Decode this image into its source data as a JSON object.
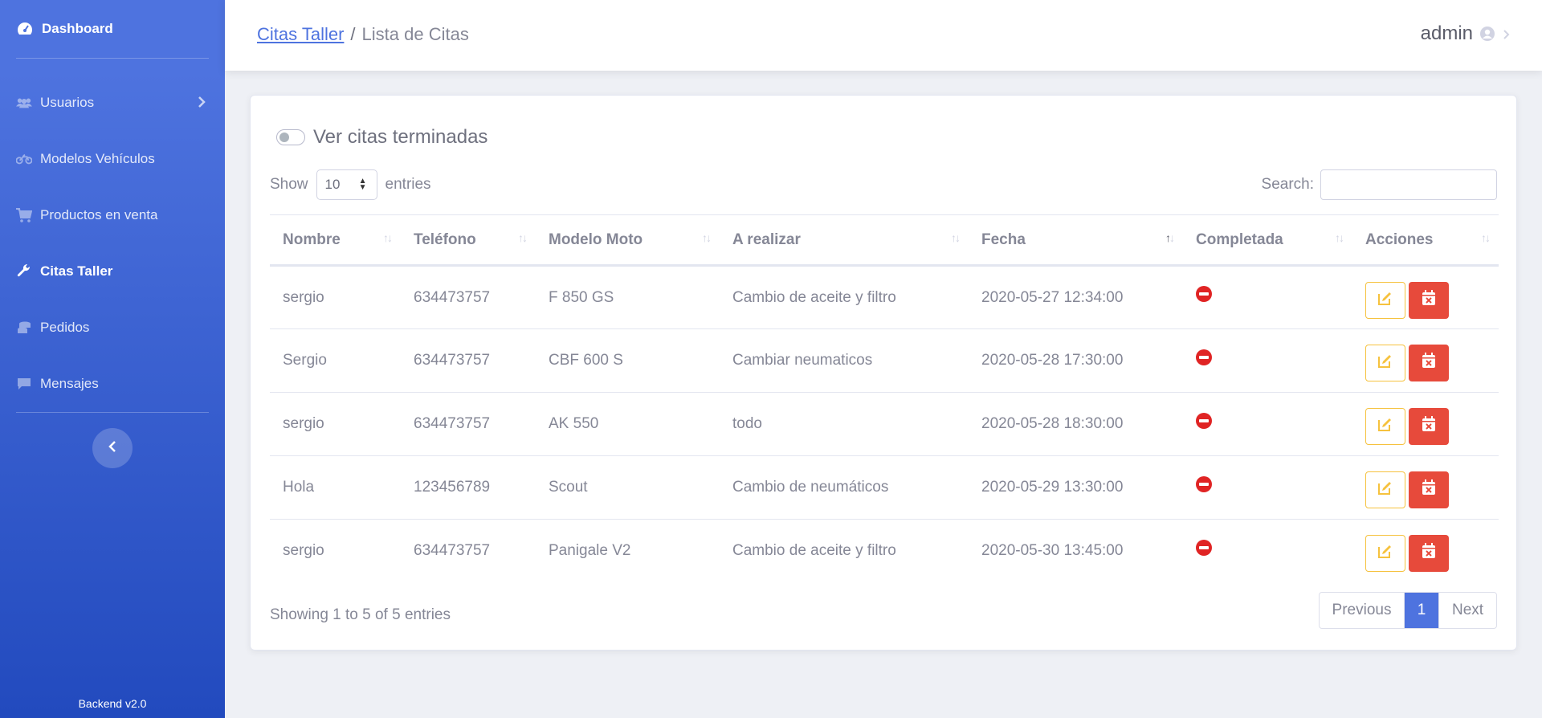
{
  "sidebar": {
    "brand": "Dashboard",
    "items": [
      {
        "label": "Usuarios",
        "icon": "users-icon"
      },
      {
        "label": "Modelos Vehículos",
        "icon": "motorcycle-icon"
      },
      {
        "label": "Productos en venta",
        "icon": "cart-icon"
      },
      {
        "label": "Citas Taller",
        "icon": "wrench-icon"
      },
      {
        "label": "Pedidos",
        "icon": "coins-icon"
      },
      {
        "label": "Mensajes",
        "icon": "comment-icon"
      }
    ],
    "version": "Backend v2.0"
  },
  "header": {
    "breadcrumb_link": "Citas Taller",
    "breadcrumb_separator": "/",
    "breadcrumb_current": "Lista de Citas",
    "user": "admin"
  },
  "controls": {
    "switch_label": "Ver citas terminadas",
    "show_label": "Show",
    "entries_value": "10",
    "entries_label": "entries",
    "search_label": "Search:"
  },
  "table": {
    "columns": [
      "Nombre",
      "Teléfono",
      "Modelo Moto",
      "A realizar",
      "Fecha",
      "Completada",
      "Acciones"
    ],
    "rows": [
      {
        "nombre": "sergio",
        "telefono": "634473757",
        "modelo": "F 850 GS",
        "realizar": "Cambio de aceite y filtro",
        "fecha": "2020-05-27 12:34:00",
        "completada": false
      },
      {
        "nombre": "Sergio",
        "telefono": "634473757",
        "modelo": "CBF 600 S",
        "realizar": "Cambiar neumaticos",
        "fecha": "2020-05-28 17:30:00",
        "completada": false
      },
      {
        "nombre": "sergio",
        "telefono": "634473757",
        "modelo": "AK 550",
        "realizar": "todo",
        "fecha": "2020-05-28 18:30:00",
        "completada": false
      },
      {
        "nombre": "Hola",
        "telefono": "123456789",
        "modelo": "Scout",
        "realizar": "Cambio de neumáticos",
        "fecha": "2020-05-29 13:30:00",
        "completada": false
      },
      {
        "nombre": "sergio",
        "telefono": "634473757",
        "modelo": "Panigale V2",
        "realizar": "Cambio de aceite y filtro",
        "fecha": "2020-05-30 13:45:00",
        "completada": false
      }
    ]
  },
  "footer": {
    "info": "Showing 1 to 5 of 5 entries",
    "previous": "Previous",
    "current_page": "1",
    "next": "Next"
  },
  "colors": {
    "primary": "#4e73df",
    "warning": "#f6c23e",
    "danger": "#e74a3b"
  }
}
